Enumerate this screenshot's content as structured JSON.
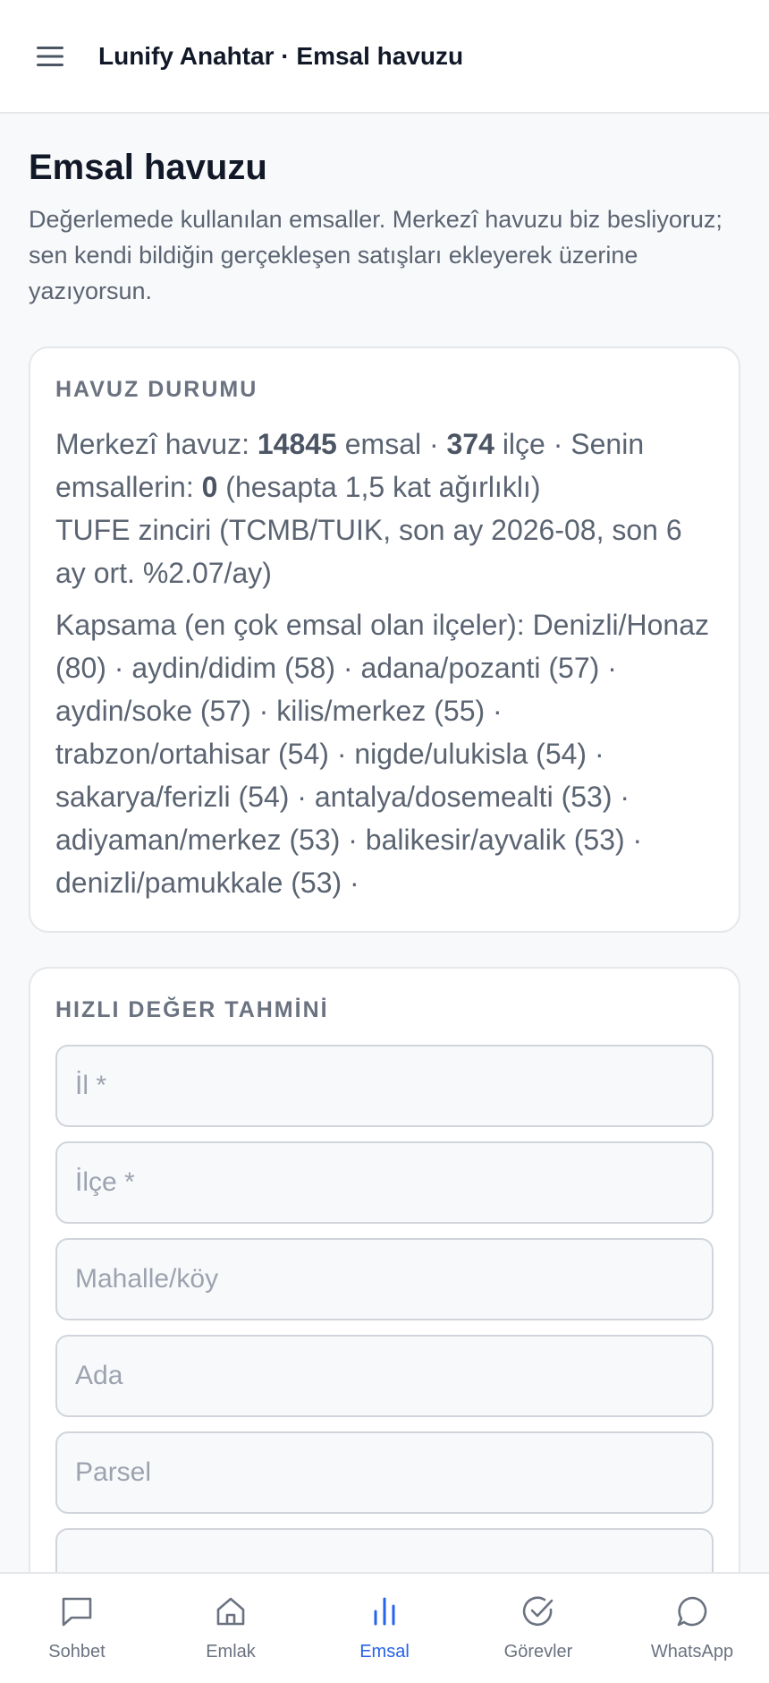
{
  "header": {
    "title": "Lunify Anahtar · Emsal havuzu",
    "menu_icon": "hamburger-menu-icon"
  },
  "page": {
    "title": "Emsal havuzu",
    "description": "Değerlemede kullanılan emsaller. Merkezî havuzu biz besliyoruz; sen kendi bildiğin gerçekleşen satışları ekleyerek üzerine yazıyorsun."
  },
  "pool_status": {
    "heading": "HAVUZ DURUMU",
    "central_label": "Merkezî havuz:",
    "central_count": "14845",
    "comps_word": "emsal ·",
    "district_count": "374",
    "district_word": "ilçe · Senin emsallerin:",
    "own_count": "0",
    "own_note": "(hesapta 1,5 kat ağırlıklı)",
    "tufe_line": "TUFE zinciri (TCMB/TUIK, son ay 2026-08, son 6 ay ort. %2.07/ay)",
    "coverage_line": "Kapsama (en çok emsal olan ilçeler): Denizli/Honaz (80) · aydin/didim (58) · adana/pozanti (57) · aydin/soke (57) · kilis/merkez (55) · trabzon/ortahisar (54) · nigde/ulukisla (54) · sakarya/ferizli (54) · antalya/dosemealti (53) · adiyaman/merkez (53) · balikesir/ayvalik (53) · denizli/pamukkale (53) ·"
  },
  "quick_estimate": {
    "heading": "HIZLI DEĞER TAHMİNİ",
    "fields": {
      "il": "İl *",
      "ilce": "İlçe *",
      "mahalle": "Mahalle/köy",
      "ada": "Ada",
      "parsel": "Parsel",
      "extra": ""
    }
  },
  "bottom_nav": {
    "items": [
      {
        "label": "Sohbet",
        "icon": "chat-bubble-icon"
      },
      {
        "label": "Emlak",
        "icon": "home-icon"
      },
      {
        "label": "Emsal",
        "icon": "bar-chart-icon"
      },
      {
        "label": "Görevler",
        "icon": "check-circle-icon"
      },
      {
        "label": "WhatsApp",
        "icon": "whatsapp-icon"
      }
    ],
    "active": "Emsal"
  },
  "colors": {
    "accent": "#2563eb",
    "text_primary": "#111827",
    "text_muted": "#5b6472",
    "border": "#e5e7eb",
    "background": "#f8f9fb"
  }
}
